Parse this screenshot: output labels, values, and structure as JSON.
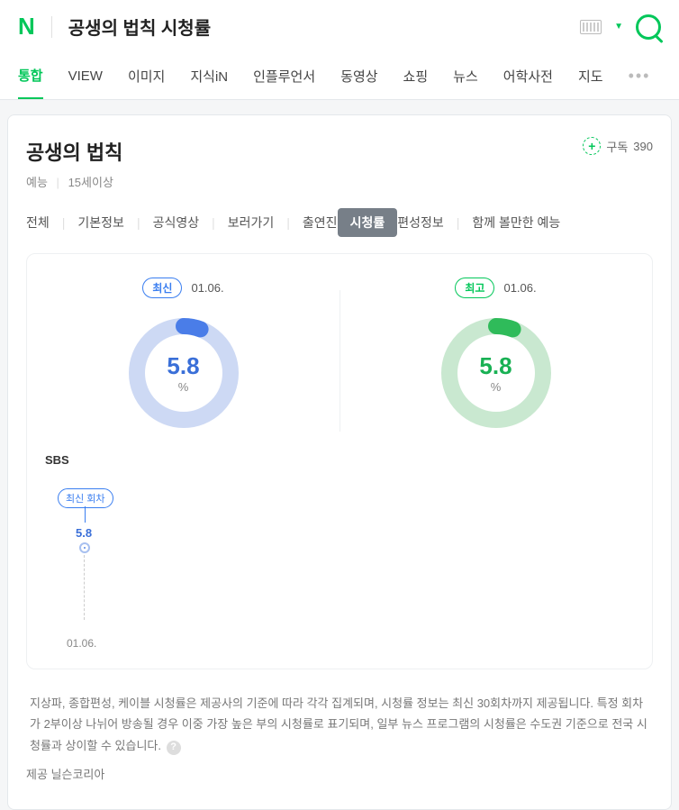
{
  "header": {
    "logo": "N",
    "search_title": "공생의 법칙 시청률"
  },
  "nav": {
    "tabs": [
      "통합",
      "VIEW",
      "이미지",
      "지식iN",
      "인플루언서",
      "동영상",
      "쇼핑",
      "뉴스",
      "어학사전",
      "지도"
    ],
    "active": 0
  },
  "show": {
    "title": "공생의 법칙",
    "genre": "예능",
    "age": "15세이상",
    "subscribe_label": "구독",
    "subscribe_count": "390"
  },
  "subtabs": {
    "items": [
      "전체",
      "기본정보",
      "공식영상",
      "보러가기",
      "출연진",
      "시청률",
      "편성정보",
      "함께 볼만한 예능"
    ],
    "active": 5
  },
  "chart_data": {
    "type": "bar",
    "gauges": [
      {
        "label": "최신",
        "date": "01.06.",
        "value": 5.8,
        "unit": "%",
        "color": "blue"
      },
      {
        "label": "최고",
        "date": "01.06.",
        "value": 5.8,
        "unit": "%",
        "color": "green"
      }
    ],
    "channel": "SBS",
    "episode_badge": "최신 회차",
    "series": {
      "x": [
        "01.06."
      ],
      "values": [
        5.8
      ]
    },
    "ylim": [
      0,
      10
    ]
  },
  "footer": {
    "note": "지상파, 종합편성, 케이블 시청률은 제공사의 기준에 따라 각각 집계되며, 시청률 정보는 최신 30회차까지 제공됩니다. 특정 회차가 2부이상 나뉘어 방송될 경우 이중 가장 높은 부의 시청률로 표기되며, 일부 뉴스 프로그램의 시청률은 수도권 기준으로 전국 시청률과 상이할 수 있습니다.",
    "provider": "제공 닐슨코리아"
  }
}
